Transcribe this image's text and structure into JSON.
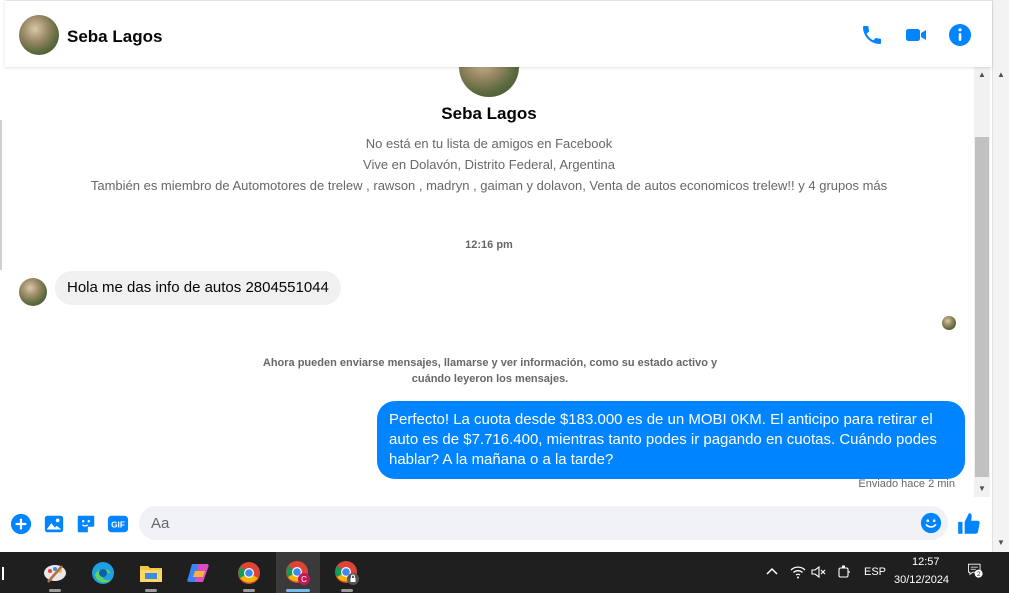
{
  "header": {
    "contact_name": "Seba Lagos",
    "icons": [
      "phone-icon",
      "video-camera-icon",
      "info-icon"
    ]
  },
  "profile": {
    "name": "Seba Lagos",
    "friend_status": "No está en tu lista de amigos en Facebook",
    "location": "Vive en Dolavón, Distrito Federal, Argentina",
    "groups": "También es miembro de Automotores de trelew , rawson , madryn , gaiman y dolavon, Venta de autos economicos trelew!! y 4 grupos más"
  },
  "conversation": {
    "timestamp": "12:16 pm",
    "incoming_message": "Hola me das info de autos 2804551044",
    "notice": "Ahora pueden enviarse mensajes, llamarse y ver información, como su estado activo y cuándo leyeron los mensajes.",
    "outgoing_message": "Perfecto! La cuota desde $183.000 es de un MOBI 0KM. El anticipo para retirar el auto es de $7.716.400, mientras tanto podes ir pagando en cuotas. Cuándo podes hablar? A la mañana o a la tarde?",
    "sent_status": "Enviado hace 2 min"
  },
  "composer": {
    "placeholder": "Aa",
    "gif_label": "GIF",
    "icons": [
      "plus-circle-icon",
      "photo-icon",
      "sticker-icon",
      "gif-icon",
      "emoji-icon",
      "like-icon"
    ]
  },
  "taskbar": {
    "apps": [
      "task-view",
      "paint",
      "edge",
      "file-explorer",
      "copilot",
      "chrome",
      "chrome-profile-c",
      "chrome-profile-locked"
    ],
    "profile_badge": "C",
    "language": "ESP",
    "time": "12:57",
    "date": "30/12/2024",
    "notification_count": "2"
  },
  "colors": {
    "accent": "#0084ff",
    "incoming_bubble": "#f0f0f0",
    "taskbar": "#1f1f1f"
  }
}
